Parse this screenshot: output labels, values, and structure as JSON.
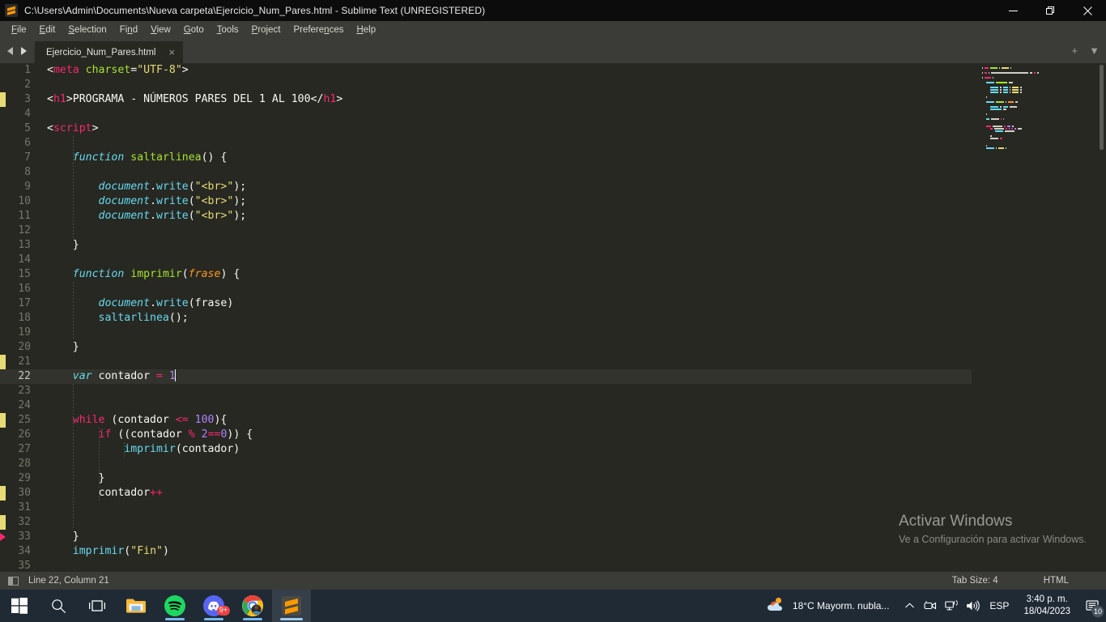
{
  "window": {
    "title": "C:\\Users\\Admin\\Documents\\Nueva carpeta\\Ejercicio_Num_Pares.html - Sublime Text (UNREGISTERED)",
    "logo_icon": "sublime-text-logo",
    "minimize_icon": "minimize-icon",
    "restore_icon": "restore-icon",
    "close_icon": "close-icon"
  },
  "menubar": {
    "items": [
      {
        "label": "File",
        "mnemonic": "F"
      },
      {
        "label": "Edit",
        "mnemonic": "E"
      },
      {
        "label": "Selection",
        "mnemonic": "S"
      },
      {
        "label": "Find",
        "mnemonic": "n"
      },
      {
        "label": "View",
        "mnemonic": "V"
      },
      {
        "label": "Goto",
        "mnemonic": "G"
      },
      {
        "label": "Tools",
        "mnemonic": "T"
      },
      {
        "label": "Project",
        "mnemonic": "P"
      },
      {
        "label": "Preferences",
        "mnemonic": "n"
      },
      {
        "label": "Help",
        "mnemonic": "H"
      }
    ]
  },
  "tabbar": {
    "prev_icon": "chevron-left-icon",
    "next_icon": "chevron-right-icon",
    "tabs": [
      {
        "label": "Ejercicio_Num_Pares.html",
        "close": "×",
        "active": true
      }
    ],
    "new_tab_label": "+",
    "menu_label": "▼"
  },
  "editor": {
    "cursor_line": 22,
    "lines": [
      {
        "n": 1,
        "tokens": [
          {
            "t": "<",
            "c": "t-punc"
          },
          {
            "t": "meta",
            "c": "t-tag"
          },
          {
            "t": " ",
            "c": "t-plain"
          },
          {
            "t": "charset",
            "c": "t-attr"
          },
          {
            "t": "=",
            "c": "t-plain"
          },
          {
            "t": "\"UTF-8\"",
            "c": "t-string"
          },
          {
            "t": ">",
            "c": "t-punc"
          }
        ]
      },
      {
        "n": 2,
        "tokens": []
      },
      {
        "n": 3,
        "tokens": [
          {
            "t": "<",
            "c": "t-punc"
          },
          {
            "t": "h1",
            "c": "t-tag"
          },
          {
            "t": ">",
            "c": "t-punc"
          },
          {
            "t": "PROGRAMA - NÚMEROS PARES DEL 1 AL 100",
            "c": "t-plain"
          },
          {
            "t": "</",
            "c": "t-punc"
          },
          {
            "t": "h1",
            "c": "t-tag"
          },
          {
            "t": ">",
            "c": "t-punc"
          }
        ]
      },
      {
        "n": 4,
        "tokens": []
      },
      {
        "n": 5,
        "tokens": [
          {
            "t": "<",
            "c": "t-punc"
          },
          {
            "t": "script",
            "c": "t-tag"
          },
          {
            "t": ">",
            "c": "t-punc"
          }
        ]
      },
      {
        "n": 6,
        "tokens": []
      },
      {
        "n": 7,
        "tokens": [
          {
            "t": "    ",
            "c": "t-plain"
          },
          {
            "t": "function",
            "c": "t-kw-i"
          },
          {
            "t": " ",
            "c": "t-plain"
          },
          {
            "t": "saltarlinea",
            "c": "t-fn"
          },
          {
            "t": "() {",
            "c": "t-punc"
          }
        ]
      },
      {
        "n": 8,
        "tokens": []
      },
      {
        "n": 9,
        "tokens": [
          {
            "t": "        ",
            "c": "t-plain"
          },
          {
            "t": "document",
            "c": "t-obj"
          },
          {
            "t": ".",
            "c": "t-punc"
          },
          {
            "t": "write",
            "c": "t-call"
          },
          {
            "t": "(",
            "c": "t-punc"
          },
          {
            "t": "\"<br>\"",
            "c": "t-string"
          },
          {
            "t": ");",
            "c": "t-punc"
          }
        ]
      },
      {
        "n": 10,
        "tokens": [
          {
            "t": "        ",
            "c": "t-plain"
          },
          {
            "t": "document",
            "c": "t-obj"
          },
          {
            "t": ".",
            "c": "t-punc"
          },
          {
            "t": "write",
            "c": "t-call"
          },
          {
            "t": "(",
            "c": "t-punc"
          },
          {
            "t": "\"<br>\"",
            "c": "t-string"
          },
          {
            "t": ");",
            "c": "t-punc"
          }
        ]
      },
      {
        "n": 11,
        "tokens": [
          {
            "t": "        ",
            "c": "t-plain"
          },
          {
            "t": "document",
            "c": "t-obj"
          },
          {
            "t": ".",
            "c": "t-punc"
          },
          {
            "t": "write",
            "c": "t-call"
          },
          {
            "t": "(",
            "c": "t-punc"
          },
          {
            "t": "\"<br>\"",
            "c": "t-string"
          },
          {
            "t": ");",
            "c": "t-punc"
          }
        ]
      },
      {
        "n": 12,
        "tokens": []
      },
      {
        "n": 13,
        "tokens": [
          {
            "t": "    }",
            "c": "t-punc"
          }
        ]
      },
      {
        "n": 14,
        "tokens": []
      },
      {
        "n": 15,
        "tokens": [
          {
            "t": "    ",
            "c": "t-plain"
          },
          {
            "t": "function",
            "c": "t-kw-i"
          },
          {
            "t": " ",
            "c": "t-plain"
          },
          {
            "t": "imprimir",
            "c": "t-fn"
          },
          {
            "t": "(",
            "c": "t-punc"
          },
          {
            "t": "frase",
            "c": "t-param"
          },
          {
            "t": ") {",
            "c": "t-punc"
          }
        ]
      },
      {
        "n": 16,
        "tokens": []
      },
      {
        "n": 17,
        "tokens": [
          {
            "t": "        ",
            "c": "t-plain"
          },
          {
            "t": "document",
            "c": "t-obj"
          },
          {
            "t": ".",
            "c": "t-punc"
          },
          {
            "t": "write",
            "c": "t-call"
          },
          {
            "t": "(frase)",
            "c": "t-punc"
          }
        ]
      },
      {
        "n": 18,
        "tokens": [
          {
            "t": "        ",
            "c": "t-plain"
          },
          {
            "t": "saltarlinea",
            "c": "t-call"
          },
          {
            "t": "();",
            "c": "t-punc"
          }
        ]
      },
      {
        "n": 19,
        "tokens": []
      },
      {
        "n": 20,
        "tokens": [
          {
            "t": "    }",
            "c": "t-punc"
          }
        ]
      },
      {
        "n": 21,
        "tokens": []
      },
      {
        "n": 22,
        "tokens": [
          {
            "t": "    ",
            "c": "t-plain"
          },
          {
            "t": "var",
            "c": "t-kw-i"
          },
          {
            "t": " contador ",
            "c": "t-plain"
          },
          {
            "t": "=",
            "c": "t-op"
          },
          {
            "t": " ",
            "c": "t-plain"
          },
          {
            "t": "1",
            "c": "t-num"
          }
        ],
        "cursor": true
      },
      {
        "n": 23,
        "tokens": []
      },
      {
        "n": 24,
        "tokens": []
      },
      {
        "n": 25,
        "tokens": [
          {
            "t": "    ",
            "c": "t-plain"
          },
          {
            "t": "while",
            "c": "t-kw"
          },
          {
            "t": " (contador ",
            "c": "t-plain"
          },
          {
            "t": "<=",
            "c": "t-op"
          },
          {
            "t": " ",
            "c": "t-plain"
          },
          {
            "t": "100",
            "c": "t-num"
          },
          {
            "t": "){",
            "c": "t-punc"
          }
        ]
      },
      {
        "n": 26,
        "tokens": [
          {
            "t": "        ",
            "c": "t-plain"
          },
          {
            "t": "if",
            "c": "t-kw"
          },
          {
            "t": " ((contador ",
            "c": "t-plain"
          },
          {
            "t": "%",
            "c": "t-op"
          },
          {
            "t": " ",
            "c": "t-plain"
          },
          {
            "t": "2",
            "c": "t-num"
          },
          {
            "t": "==",
            "c": "t-op"
          },
          {
            "t": "0",
            "c": "t-num"
          },
          {
            "t": ")) {",
            "c": "t-punc"
          }
        ]
      },
      {
        "n": 27,
        "tokens": [
          {
            "t": "            ",
            "c": "t-plain"
          },
          {
            "t": "imprimir",
            "c": "t-call"
          },
          {
            "t": "(contador)",
            "c": "t-punc"
          }
        ]
      },
      {
        "n": 28,
        "tokens": []
      },
      {
        "n": 29,
        "tokens": [
          {
            "t": "        }",
            "c": "t-punc"
          }
        ]
      },
      {
        "n": 30,
        "tokens": [
          {
            "t": "        contador",
            "c": "t-plain"
          },
          {
            "t": "++",
            "c": "t-op"
          }
        ]
      },
      {
        "n": 31,
        "tokens": []
      },
      {
        "n": 32,
        "tokens": []
      },
      {
        "n": 33,
        "tokens": [
          {
            "t": "    }",
            "c": "t-punc"
          }
        ]
      },
      {
        "n": 34,
        "tokens": [
          {
            "t": "    ",
            "c": "t-plain"
          },
          {
            "t": "imprimir",
            "c": "t-call"
          },
          {
            "t": "(",
            "c": "t-punc"
          },
          {
            "t": "\"Fin\"",
            "c": "t-string"
          },
          {
            "t": ")",
            "c": "t-punc"
          }
        ]
      },
      {
        "n": 35,
        "tokens": []
      }
    ],
    "gutter_markers": [
      {
        "line": 3,
        "type": "yellow"
      },
      {
        "line": 21,
        "type": "yellow"
      },
      {
        "line": 22,
        "type": "red"
      },
      {
        "line": 25,
        "type": "yellow"
      },
      {
        "line": 30,
        "type": "yellow"
      },
      {
        "line": 32,
        "type": "yellow"
      },
      {
        "line": 33,
        "type": "red"
      }
    ]
  },
  "watermark": {
    "title": "Activar Windows",
    "subtitle": "Ve a Configuración para activar Windows."
  },
  "statusbar": {
    "sidebar_icon": "sidebar-toggle-icon",
    "position": "Line 22, Column 21",
    "tab_size": "Tab Size: 4",
    "syntax": "HTML"
  },
  "taskbar": {
    "items": [
      {
        "name": "start-button",
        "icon": "windows-logo-icon",
        "active": false,
        "running": false
      },
      {
        "name": "search-button",
        "icon": "search-icon",
        "active": false,
        "running": false
      },
      {
        "name": "task-view-button",
        "icon": "task-view-icon",
        "active": false,
        "running": false
      },
      {
        "name": "file-explorer",
        "icon": "folder-icon",
        "active": false,
        "running": false
      },
      {
        "name": "spotify",
        "icon": "spotify-icon",
        "active": false,
        "running": true
      },
      {
        "name": "discord",
        "icon": "discord-icon",
        "active": false,
        "running": true,
        "badge": "9+"
      },
      {
        "name": "chrome",
        "icon": "chrome-icon",
        "active": false,
        "running": true
      },
      {
        "name": "sublime-text",
        "icon": "sublime-text-icon",
        "active": true,
        "running": true
      }
    ],
    "weather": {
      "icon": "partly-cloudy-icon",
      "temperature": "18°C",
      "condition": "Mayorm. nubla..."
    },
    "tray": {
      "overflow_icon": "chevron-up-icon",
      "icons": [
        "camera-icon",
        "network-icon",
        "volume-icon"
      ],
      "language": "ESP"
    },
    "clock": {
      "time": "3:40 p. m.",
      "date": "18/04/2023"
    },
    "notifications": {
      "icon": "notification-icon",
      "count": "10"
    }
  },
  "colors": {
    "editor_bg": "#272822",
    "chrome_bg": "#3b3b37",
    "accent_pink": "#f92672",
    "accent_green": "#a6e22e",
    "accent_cyan": "#66d9ef",
    "accent_yellow": "#e6db74",
    "accent_purple": "#ae81ff",
    "accent_orange": "#fd971f",
    "taskbar_bg": "#1f2a35"
  }
}
